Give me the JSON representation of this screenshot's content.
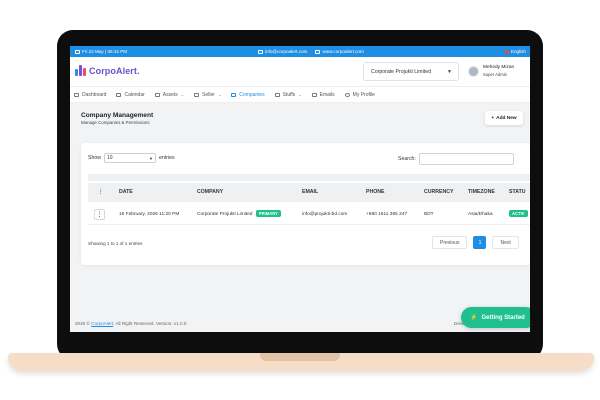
{
  "topbar": {
    "datetime": "Fri 22 May | 05:42 PM",
    "email": "info@corpoalert.com",
    "website": "www.corpoalert.com",
    "language": "English"
  },
  "header": {
    "logo_text": "CorpoAlert.",
    "company_select": "Corporate Projukti Limited",
    "user_name": "Mehedy Mizan",
    "user_role": "Super Admin"
  },
  "nav": {
    "items": [
      {
        "label": "Dashboard"
      },
      {
        "label": "Calendar"
      },
      {
        "label": "Assets"
      },
      {
        "label": "Seller"
      },
      {
        "label": "Companies"
      },
      {
        "label": "Stuffs"
      },
      {
        "label": "Emails"
      },
      {
        "label": "My Profile"
      }
    ]
  },
  "page": {
    "title": "Company Management",
    "subtitle": "Manage Companies & Permissions",
    "add_button": "Add New"
  },
  "table": {
    "show_label": "Show",
    "show_value": "10",
    "entries_label": "entries",
    "search_label": "Search:",
    "columns": [
      "DATE",
      "COMPANY",
      "EMAIL",
      "PHONE",
      "CURRENCY",
      "TIMEZONE",
      "STATU"
    ],
    "rows": [
      {
        "date": "16 February, 2026 11:20 PM",
        "company": "Corporate Projukti Limited",
        "badge": "PRIMARY",
        "email": "info@projukti-bd.com",
        "phone": "+880 1611 365 247",
        "currency": "BDT",
        "timezone": "Asia/Dhaka",
        "status": "ACTIV"
      }
    ],
    "info": "Showing 1 to 1 of 1 entries",
    "prev": "Previous",
    "page": "1",
    "next": "Next"
  },
  "footer": {
    "year": "2026 ©",
    "brand": "CorpoAlert",
    "rest": ". All Right Reserved. Version: v1.0.0",
    "right": "Deve"
  },
  "cta": {
    "label": "Getting Started"
  },
  "colors": {
    "primary": "#1d8ee3",
    "success": "#1fc08d",
    "brand": "#6b4fcf"
  }
}
